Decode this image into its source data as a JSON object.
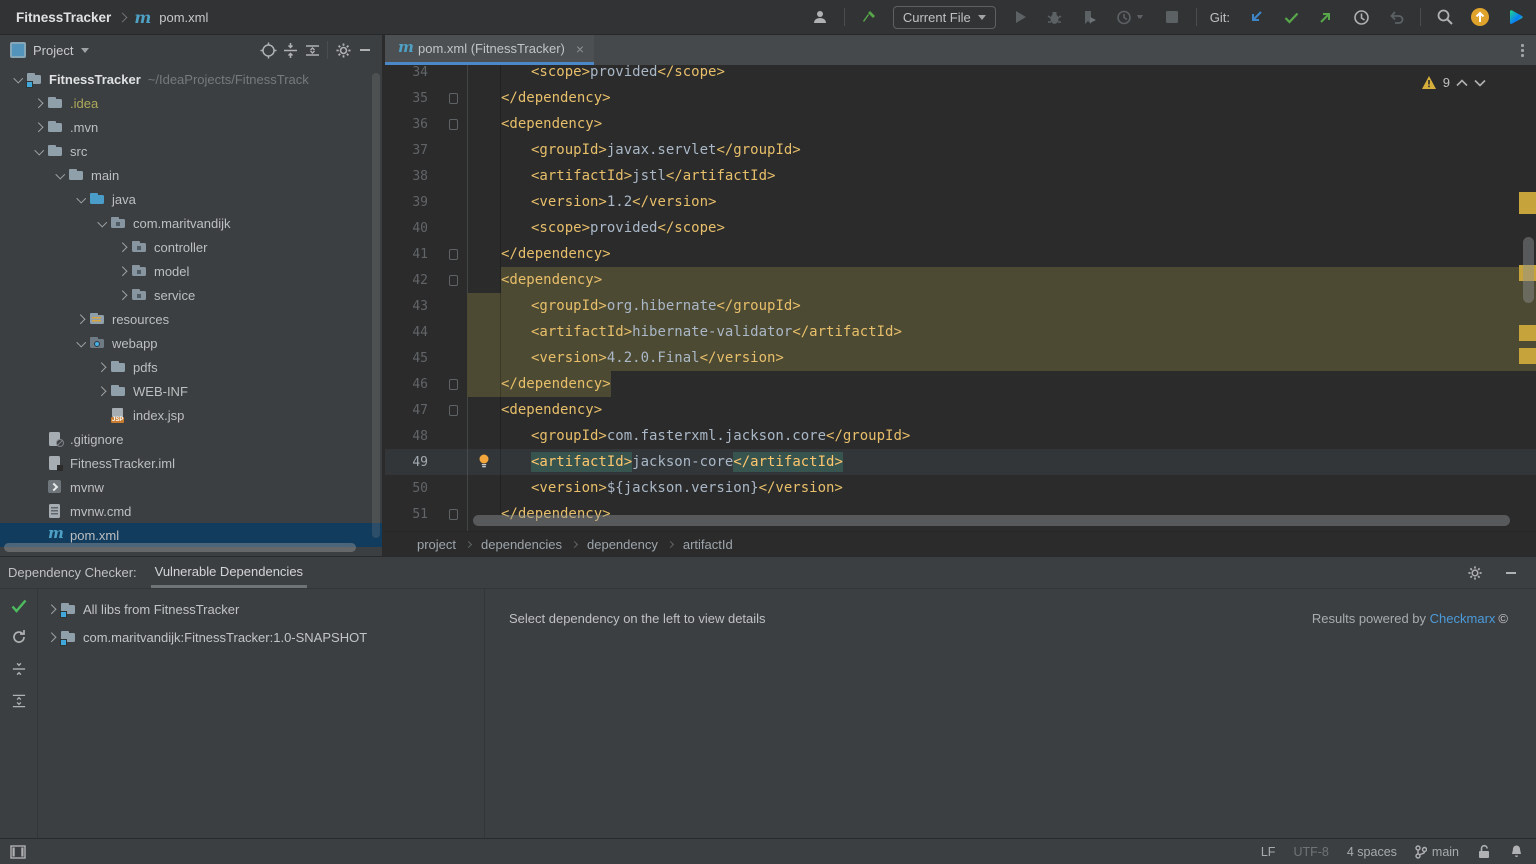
{
  "titlebar": {
    "project": "FitnessTracker",
    "file": "pom.xml"
  },
  "toolbar": {
    "run_config": "Current File",
    "git_label": "Git:"
  },
  "tab": {
    "label": "pom.xml (FitnessTracker)",
    "close": "×"
  },
  "project_panel": {
    "title": "Project",
    "items": [
      {
        "label": "FitnessTracker",
        "path": "~/IdeaProjects/FitnessTrack",
        "level": 0,
        "chevron": "d",
        "icon": "project",
        "bold": true
      },
      {
        "label": ".idea",
        "level": 1,
        "chevron": "r",
        "icon": "folder",
        "excluded": true
      },
      {
        "label": ".mvn",
        "level": 1,
        "chevron": "r",
        "icon": "folder"
      },
      {
        "label": "src",
        "level": 1,
        "chevron": "d",
        "icon": "folder"
      },
      {
        "label": "main",
        "level": 2,
        "chevron": "d",
        "icon": "folder"
      },
      {
        "label": "java",
        "level": 3,
        "chevron": "d",
        "icon": "src"
      },
      {
        "label": "com.maritvandijk",
        "level": 4,
        "chevron": "d",
        "icon": "pkg"
      },
      {
        "label": "controller",
        "level": 5,
        "chevron": "r",
        "icon": "pkg"
      },
      {
        "label": "model",
        "level": 5,
        "chevron": "r",
        "icon": "pkg"
      },
      {
        "label": "service",
        "level": 5,
        "chevron": "r",
        "icon": "pkg"
      },
      {
        "label": "resources",
        "level": 3,
        "chevron": "r",
        "icon": "resources"
      },
      {
        "label": "webapp",
        "level": 3,
        "chevron": "d",
        "icon": "webapp"
      },
      {
        "label": "pdfs",
        "level": 4,
        "chevron": "r",
        "icon": "folder"
      },
      {
        "label": "WEB-INF",
        "level": 4,
        "chevron": "r",
        "icon": "folder"
      },
      {
        "label": "index.jsp",
        "level": 4,
        "chevron": "",
        "icon": "jsp"
      },
      {
        "label": ".gitignore",
        "level": 1,
        "chevron": "",
        "icon": "ignored"
      },
      {
        "label": "FitnessTracker.iml",
        "level": 1,
        "chevron": "",
        "icon": "iml"
      },
      {
        "label": "mvnw",
        "level": 1,
        "chevron": "",
        "icon": "sh"
      },
      {
        "label": "mvnw.cmd",
        "level": 1,
        "chevron": "",
        "icon": "txt"
      },
      {
        "label": "pom.xml",
        "level": 1,
        "chevron": "",
        "icon": "maven",
        "selected": true
      }
    ]
  },
  "editor": {
    "warning_count": "9",
    "breadcrumbs": [
      "project",
      "dependencies",
      "dependency",
      "artifactId"
    ],
    "lines": [
      {
        "n": "34",
        "ind": 3,
        "parts": [
          [
            "t",
            "<scope>"
          ],
          [
            "c",
            "provided"
          ],
          [
            "t",
            "</scope>"
          ]
        ]
      },
      {
        "n": "35",
        "ind": 2,
        "fold": "end",
        "parts": [
          [
            "t",
            "</dependency>"
          ]
        ]
      },
      {
        "n": "36",
        "ind": 2,
        "fold": "start",
        "parts": [
          [
            "t",
            "<dependency>"
          ]
        ]
      },
      {
        "n": "37",
        "ind": 3,
        "parts": [
          [
            "t",
            "<groupId>"
          ],
          [
            "c",
            "javax.servlet"
          ],
          [
            "t",
            "</groupId>"
          ]
        ]
      },
      {
        "n": "38",
        "ind": 3,
        "parts": [
          [
            "t",
            "<artifactId>"
          ],
          [
            "c",
            "jstl"
          ],
          [
            "t",
            "</artifactId>"
          ]
        ]
      },
      {
        "n": "39",
        "ind": 3,
        "parts": [
          [
            "t",
            "<version>"
          ],
          [
            "c",
            "1.2"
          ],
          [
            "t",
            "</version>"
          ]
        ]
      },
      {
        "n": "40",
        "ind": 3,
        "parts": [
          [
            "t",
            "<scope>"
          ],
          [
            "c",
            "provided"
          ],
          [
            "t",
            "</scope>"
          ]
        ]
      },
      {
        "n": "41",
        "ind": 2,
        "fold": "end",
        "parts": [
          [
            "t",
            "</dependency>"
          ]
        ]
      },
      {
        "n": "42",
        "ind": 2,
        "fold": "start",
        "hl": "text-right",
        "parts": [
          [
            "t",
            "<dependency>"
          ]
        ]
      },
      {
        "n": "43",
        "ind": 3,
        "hl": "full",
        "parts": [
          [
            "t",
            "<groupId>"
          ],
          [
            "c",
            "org.hibernate"
          ],
          [
            "t",
            "</groupId>"
          ]
        ]
      },
      {
        "n": "44",
        "ind": 3,
        "hl": "full",
        "parts": [
          [
            "t",
            "<artifactId>"
          ],
          [
            "c",
            "hibernate-validator"
          ],
          [
            "t",
            "</artifactId>"
          ]
        ]
      },
      {
        "n": "45",
        "ind": 3,
        "hl": "full",
        "parts": [
          [
            "t",
            "<version>"
          ],
          [
            "c",
            "4.2.0.Final"
          ],
          [
            "t",
            "</version>"
          ]
        ]
      },
      {
        "n": "46",
        "ind": 2,
        "fold": "end",
        "hl": "gutter-text",
        "parts": [
          [
            "t",
            "</dependency>"
          ]
        ]
      },
      {
        "n": "47",
        "ind": 2,
        "fold": "start",
        "parts": [
          [
            "t",
            "<dependency>"
          ]
        ]
      },
      {
        "n": "48",
        "ind": 3,
        "parts": [
          [
            "t",
            "<groupId>"
          ],
          [
            "c",
            "com.fasterxml.jackson.core"
          ],
          [
            "t",
            "</groupId>"
          ]
        ]
      },
      {
        "n": "49",
        "ind": 3,
        "caret": true,
        "bulb": true,
        "parts": [
          [
            "m",
            "<artifactId>"
          ],
          [
            "c",
            "jackson-core"
          ],
          [
            "m",
            "</artifactId>"
          ]
        ]
      },
      {
        "n": "50",
        "ind": 3,
        "parts": [
          [
            "t",
            "<version>"
          ],
          [
            "c",
            "${jackson.version}"
          ],
          [
            "t",
            "</version>"
          ]
        ]
      },
      {
        "n": "51",
        "ind": 2,
        "fold": "end",
        "parts": [
          [
            "t",
            "</dependency>"
          ]
        ]
      }
    ]
  },
  "dependency_checker": {
    "title": "Dependency Checker:",
    "tab": "Vulnerable Dependencies",
    "items": [
      {
        "label": "All libs from FitnessTracker"
      },
      {
        "label": "com.maritvandijk:FitnessTracker:1.0-SNAPSHOT"
      }
    ],
    "empty_text": "Select dependency on the left to view details",
    "powered_by": "Results powered by",
    "brand": "Checkmarx",
    "copyright": "©"
  },
  "status_bar": {
    "line_sep": "LF",
    "encoding": "UTF-8",
    "indent": "4 spaces",
    "branch": "main"
  },
  "colors": {
    "accent": "#4A88C7",
    "warning_stripe": "#C7A33C",
    "vulnerable_highlight": "#4D4A33",
    "link": "#4B9BDB",
    "selection": "#113C5E"
  }
}
